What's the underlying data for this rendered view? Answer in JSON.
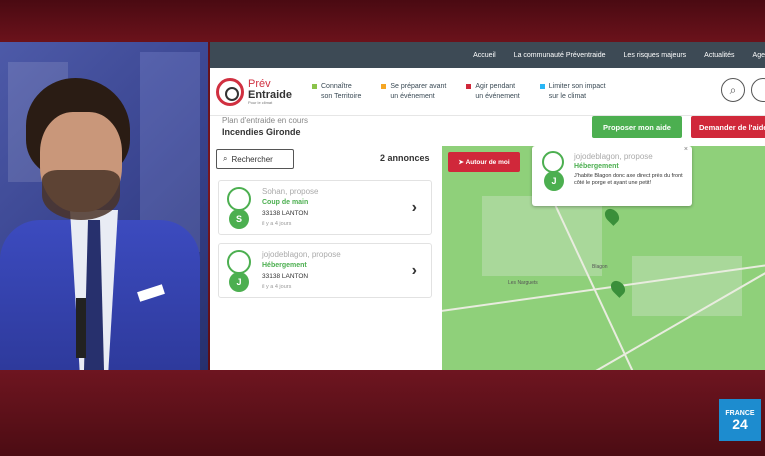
{
  "topnav": [
    "Accueil",
    "La communauté Préventraide",
    "Les risques majeurs",
    "Actualités",
    "Age"
  ],
  "logo": {
    "line1": "Prév",
    "line2": "Entraide",
    "tagline": "Pour le climat"
  },
  "header_nav": [
    {
      "line1": "Connaître",
      "line2": "son Territoire",
      "color": "#8bc34a"
    },
    {
      "line1": "Se préparer avant",
      "line2": "un événement",
      "color": "#f5a623"
    },
    {
      "line1": "Agir pendant",
      "line2": "un événement",
      "color": "#d0283a"
    },
    {
      "line1": "Limiter son impact",
      "line2": "sur le climat",
      "color": "#29b6f6"
    }
  ],
  "plan": {
    "label": "Plan d'entraide en cours",
    "title": "Incendies Gironde"
  },
  "buttons": {
    "offer_help": "Proposer mon aide",
    "request_help": "Demander de l'aide",
    "search": "Rechercher",
    "around_me": "Autour de moi"
  },
  "listing_count": "2 annonces",
  "cards": [
    {
      "user": "Sohan, propose",
      "avatar_letter": "S",
      "category": "Coup de main",
      "location": "33138 LANTON",
      "time": "il y a 4 jours"
    },
    {
      "user": "jojodeblagon, propose",
      "avatar_letter": "J",
      "category": "Hébergement",
      "location": "33138 LANTON",
      "time": "il y a 4 jours"
    }
  ],
  "popup": {
    "user": "jojodeblagon, propose",
    "avatar_letter": "J",
    "category": "Hébergement",
    "message": "J'habite Blagon donc axe direct près du front côté le porge et ayant une petit!",
    "close": "×"
  },
  "map_labels": {
    "place1": "Blagon",
    "place2": "Les Narguets"
  },
  "channel_logo": {
    "line1": "FRANCE",
    "line2": "24"
  },
  "icons": [
    "search-icon",
    "navigation-arrow-icon",
    "chevron-right-icon",
    "location-pin-icon",
    "close-icon"
  ]
}
